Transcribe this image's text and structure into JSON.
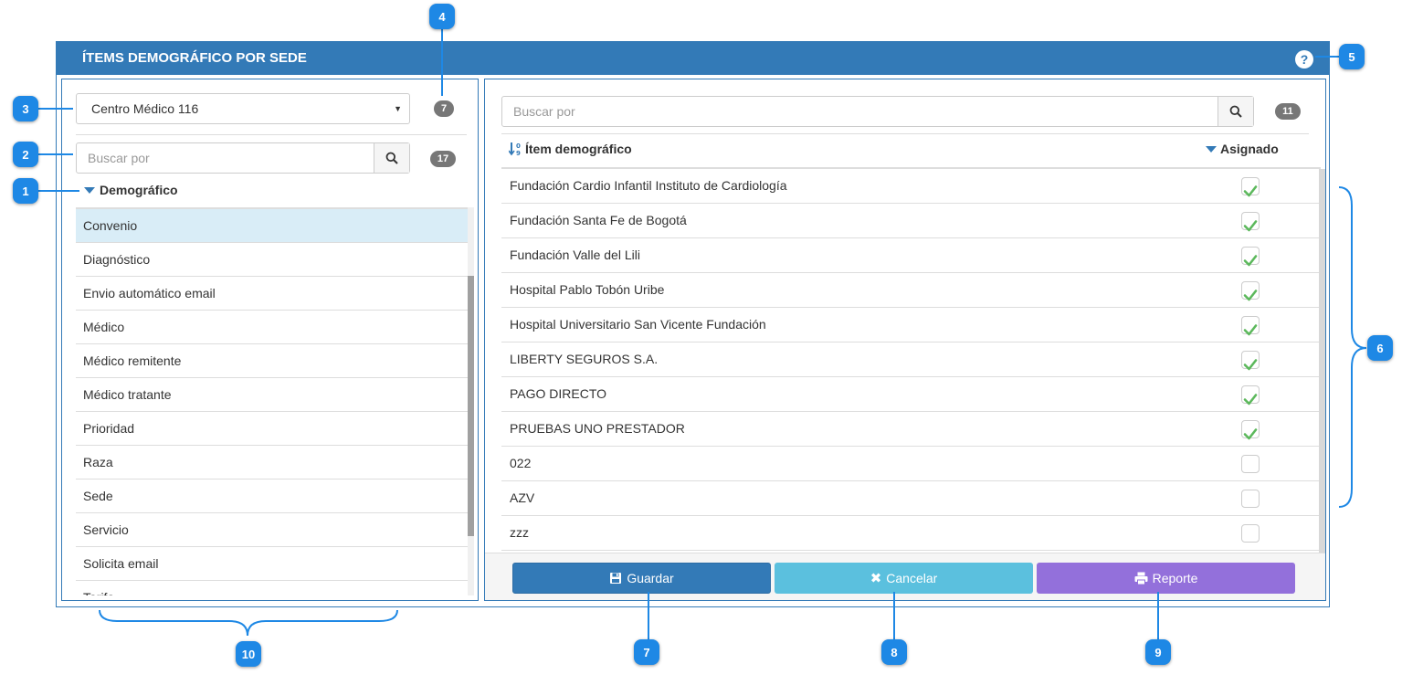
{
  "panel": {
    "title": "ÍTEMS DEMOGRÁFICO POR SEDE"
  },
  "left": {
    "sede_select": "Centro Médico 116",
    "sede_count": "7",
    "search_placeholder": "Buscar por",
    "search_count": "17",
    "tree_label": "Demográfico",
    "items": [
      "Convenio",
      "Diagnóstico",
      "Envio automático email",
      "Médico",
      "Médico remitente",
      "Médico tratante",
      "Prioridad",
      "Raza",
      "Sede",
      "Servicio",
      "Solicita email",
      "Tarifa"
    ]
  },
  "right": {
    "search_placeholder": "Buscar por",
    "count": "11",
    "col_item": "Ítem demográfico",
    "col_assigned": "Asignado",
    "rows": [
      {
        "name": "Fundación Cardio Infantil Instituto de Cardiología",
        "assigned": true
      },
      {
        "name": "Fundación Santa Fe de Bogotá",
        "assigned": true
      },
      {
        "name": "Fundación Valle del Lili",
        "assigned": true
      },
      {
        "name": "Hospital Pablo Tobón Uribe",
        "assigned": true
      },
      {
        "name": "Hospital Universitario San Vicente Fundación",
        "assigned": true
      },
      {
        "name": "LIBERTY SEGUROS S.A.",
        "assigned": true
      },
      {
        "name": "PAGO DIRECTO",
        "assigned": true
      },
      {
        "name": "PRUEBAS UNO PRESTADOR",
        "assigned": true
      },
      {
        "name": "022",
        "assigned": false
      },
      {
        "name": "AZV",
        "assigned": false
      },
      {
        "name": "zzz",
        "assigned": false
      }
    ]
  },
  "buttons": {
    "save": "Guardar",
    "cancel": "Cancelar",
    "report": "Reporte"
  },
  "callouts": [
    "1",
    "2",
    "3",
    "4",
    "5",
    "6",
    "7",
    "8",
    "9",
    "10"
  ],
  "colors": {
    "primary": "#337ab7",
    "info": "#5bc0de",
    "report": "#9370db",
    "callout": "#1e88e5",
    "check": "#5cb85c"
  }
}
